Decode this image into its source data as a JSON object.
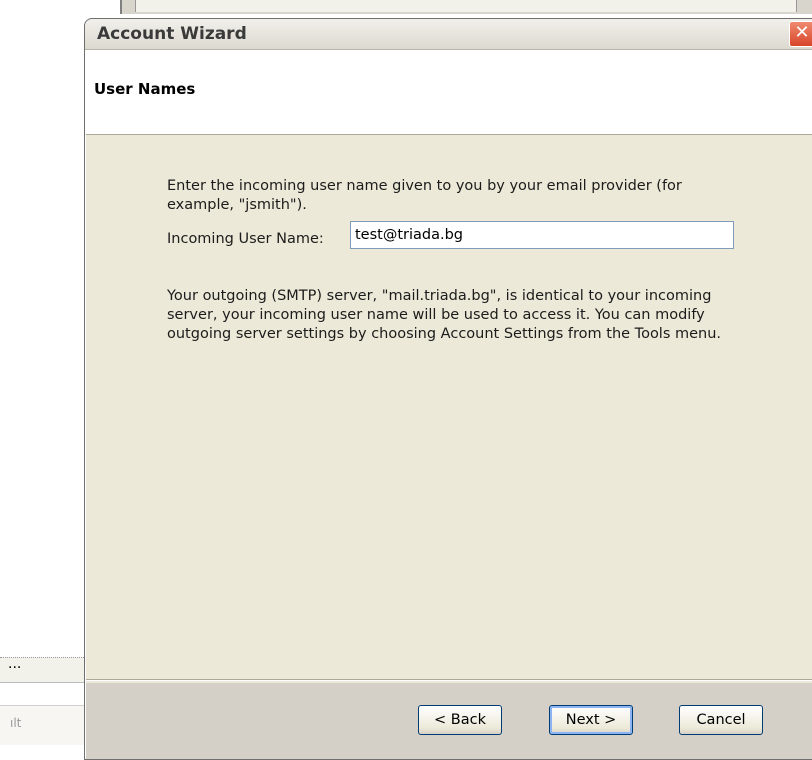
{
  "background": {
    "left_ellipsis": "...",
    "left_truncated_text": "ılt"
  },
  "window": {
    "title": "Account Wizard",
    "close_symbol": "✕"
  },
  "page": {
    "heading": "User Names",
    "intro_text": "Enter the incoming user name given to you by your email provider (for example, \"jsmith\").",
    "username_label": "Incoming User Name:",
    "username_value": "test@triada.bg",
    "smtp_text": "Your outgoing (SMTP) server, \"mail.triada.bg\", is identical to your incoming server, your incoming user name will be used to access it. You can modify outgoing server settings by choosing Account Settings from the Tools menu."
  },
  "buttons": {
    "back": "< Back",
    "next": "Next >",
    "cancel": "Cancel"
  }
}
